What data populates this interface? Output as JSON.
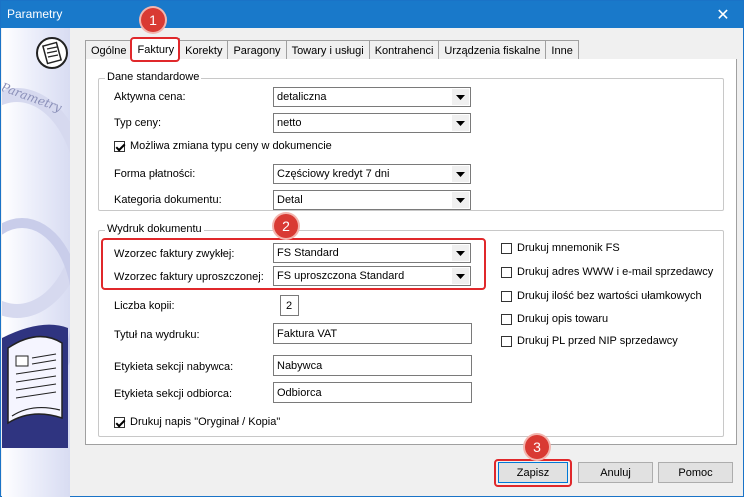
{
  "window": {
    "title": "Parametry",
    "close_symbol": "✕"
  },
  "sidebar": {
    "brand_text": "Parametry"
  },
  "tabs": [
    {
      "label": "Ogólne"
    },
    {
      "label": "Faktury",
      "active": true
    },
    {
      "label": "Korekty"
    },
    {
      "label": "Paragony"
    },
    {
      "label": "Towary i usługi"
    },
    {
      "label": "Kontrahenci"
    },
    {
      "label": "Urządzenia fiskalne"
    },
    {
      "label": "Inne"
    }
  ],
  "dane": {
    "legend": "Dane standardowe",
    "aktywna_cena": {
      "label": "Aktywna cena:",
      "value": "detaliczna"
    },
    "typ_ceny": {
      "label": "Typ ceny:",
      "value": "netto"
    },
    "zmiana_typu": {
      "label": "Możliwa zmiana typu ceny w dokumencie",
      "checked": true
    },
    "forma_platnosci": {
      "label": "Forma płatności:",
      "value": "Częściowy kredyt 7 dni"
    },
    "kategoria": {
      "label": "Kategoria dokumentu:",
      "value": "Detal"
    }
  },
  "wydruk": {
    "legend": "Wydruk dokumentu",
    "wzorzec_zwykly": {
      "label": "Wzorzec faktury zwykłej:",
      "value": "FS Standard"
    },
    "wzorzec_uproszczony": {
      "label": "Wzorzec faktury uproszczonej:",
      "value": "FS uproszczona Standard"
    },
    "liczba_kopii": {
      "label": "Liczba kopii:",
      "value": "2"
    },
    "tytul": {
      "label": "Tytuł na wydruku:",
      "value": "Faktura VAT"
    },
    "etykieta_nabywca": {
      "label": "Etykieta sekcji nabywca:",
      "value": "Nabywca"
    },
    "etykieta_odbiorca": {
      "label": "Etykieta sekcji odbiorca:",
      "value": "Odbiorca"
    },
    "oryginal_kopia": {
      "label": "Drukuj napis \"Oryginał / Kopia\"",
      "checked": true
    },
    "options": [
      {
        "label": "Drukuj mnemonik FS",
        "checked": false
      },
      {
        "label": "Drukuj adres WWW i e-mail sprzedawcy",
        "checked": false
      },
      {
        "label": "Drukuj ilość bez wartości ułamkowych",
        "checked": false
      },
      {
        "label": "Drukuj opis towaru",
        "checked": false
      },
      {
        "label": "Drukuj PL przed NIP sprzedawcy",
        "checked": false
      }
    ]
  },
  "buttons": {
    "save": "Zapisz",
    "cancel": "Anuluj",
    "help": "Pomoc"
  },
  "annotations": {
    "step1": "1",
    "step2": "2",
    "step3": "3",
    "highlight_color": "#e0282b"
  }
}
